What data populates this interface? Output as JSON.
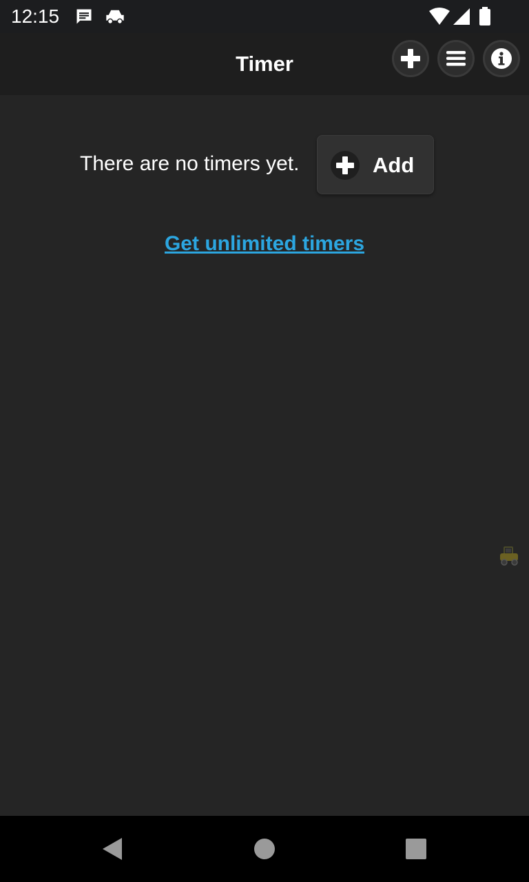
{
  "status_bar": {
    "time": "12:15",
    "icons": [
      "message-icon",
      "car-icon",
      "wifi-icon",
      "signal-icon",
      "battery-icon"
    ]
  },
  "app_bar": {
    "title": "Timer",
    "actions": [
      "add-icon",
      "menu-icon",
      "info-icon"
    ]
  },
  "main": {
    "empty_message": "There are no timers yet.",
    "add_button_label": "Add",
    "upgrade_link": "Get unlimited timers"
  },
  "nav_bar": {
    "buttons": [
      "back-icon",
      "home-icon",
      "recents-icon"
    ]
  },
  "colors": {
    "background": "#252525",
    "app_bar": "#1e1e1e",
    "status_bar": "#1c1d1f",
    "link": "#2ca6e0",
    "text": "#ffffff"
  }
}
